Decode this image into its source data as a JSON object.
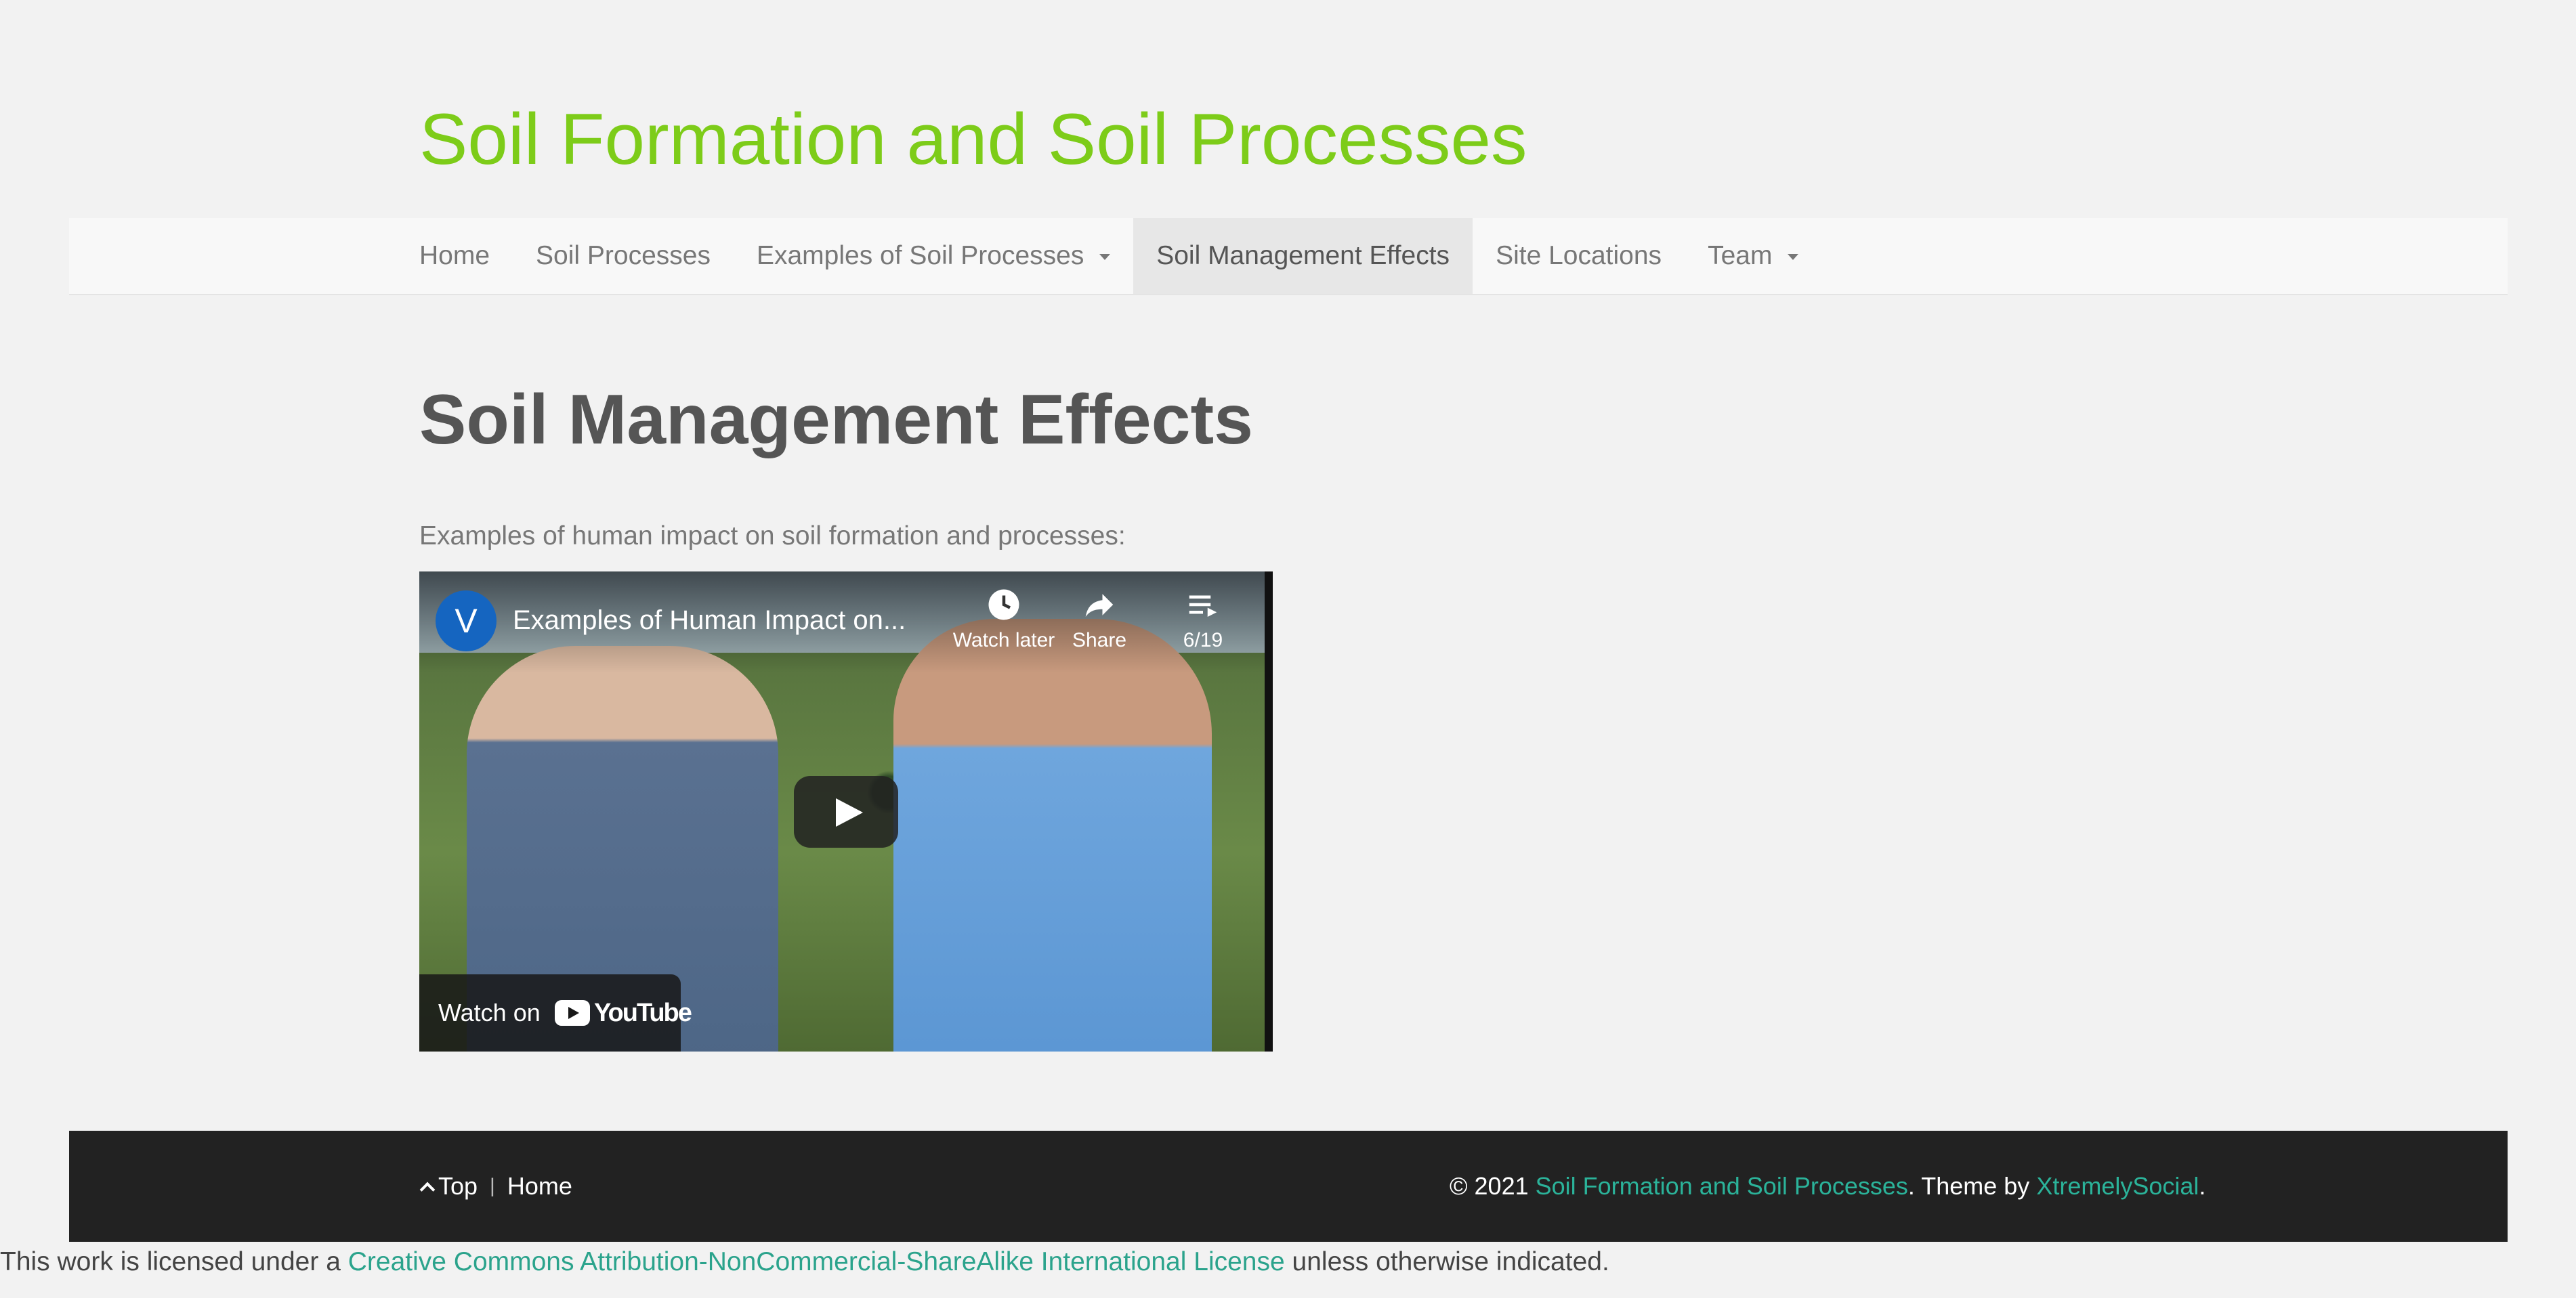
{
  "site": {
    "title": "Soil Formation and Soil Processes"
  },
  "nav": {
    "items": [
      {
        "label": "Home",
        "dropdown": false,
        "active": false
      },
      {
        "label": "Soil Processes",
        "dropdown": false,
        "active": false
      },
      {
        "label": "Examples of Soil Processes",
        "dropdown": true,
        "active": false
      },
      {
        "label": "Soil Management Effects",
        "dropdown": false,
        "active": true
      },
      {
        "label": "Site Locations",
        "dropdown": false,
        "active": false
      },
      {
        "label": "Team",
        "dropdown": true,
        "active": false
      }
    ]
  },
  "main": {
    "heading": "Soil Management Effects",
    "intro": "Examples of human impact on soil formation and processes:"
  },
  "video": {
    "channel_initial": "V",
    "title": "Examples of Human Impact on...",
    "watch_later": "Watch later",
    "share": "Share",
    "playlist_position": "6/19",
    "watch_on": "Watch on",
    "youtube_word": "YouTube"
  },
  "footer": {
    "top_label": "Top",
    "home_label": "Home",
    "copyright_prefix": "© 2021",
    "site_link": "Soil Formation and Soil Processes",
    "theme_by": ". Theme by",
    "theme_link": "XtremelySocial",
    "end": "."
  },
  "license": {
    "prefix": "This work is licensed under a",
    "link": "Creative Commons Attribution-NonCommercial-ShareAlike International License",
    "suffix": "unless otherwise indicated."
  },
  "colors": {
    "site_title": "#7dcc19",
    "footer_bg": "#222222",
    "link": "#2bb39a",
    "channel_avatar": "#1565c0"
  }
}
